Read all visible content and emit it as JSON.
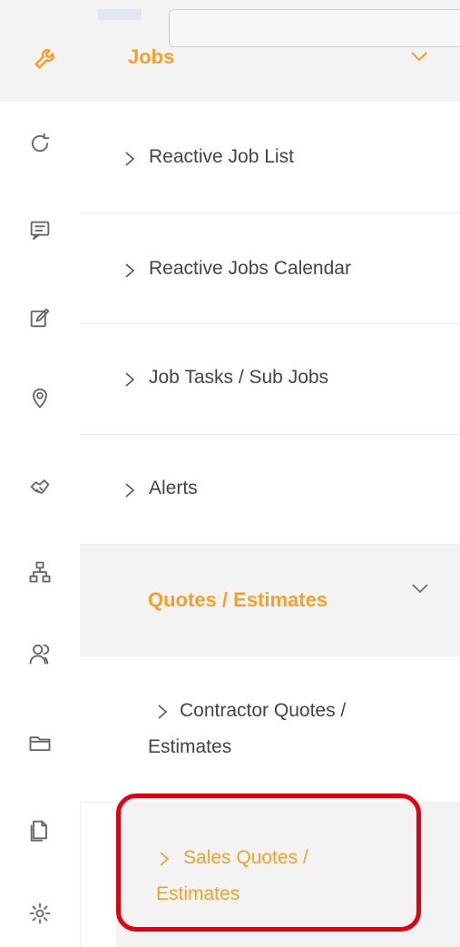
{
  "header": {
    "title": "Jobs"
  },
  "menu": {
    "items": [
      {
        "label": "Reactive Job List"
      },
      {
        "label": "Reactive Jobs Calendar"
      },
      {
        "label": "Job Tasks / Sub Jobs"
      },
      {
        "label": "Alerts"
      }
    ],
    "group": {
      "label": "Quotes / Estimates",
      "sub_items": [
        {
          "line1": "Contractor Quotes /",
          "line2": "Estimates"
        },
        {
          "line1": "Sales Quotes /",
          "line2": "Estimates"
        }
      ]
    }
  },
  "rail": {
    "icons": [
      "wrench-icon",
      "refresh-icon",
      "chat-icon",
      "edit-icon",
      "location-icon",
      "handshake-icon",
      "hierarchy-icon",
      "users-icon",
      "folder-icon",
      "documents-icon",
      "settings-icon"
    ]
  },
  "colors": {
    "accent": "#f5a02a",
    "highlight": "#e3000f",
    "selected_bg": "#f3f3f3"
  }
}
